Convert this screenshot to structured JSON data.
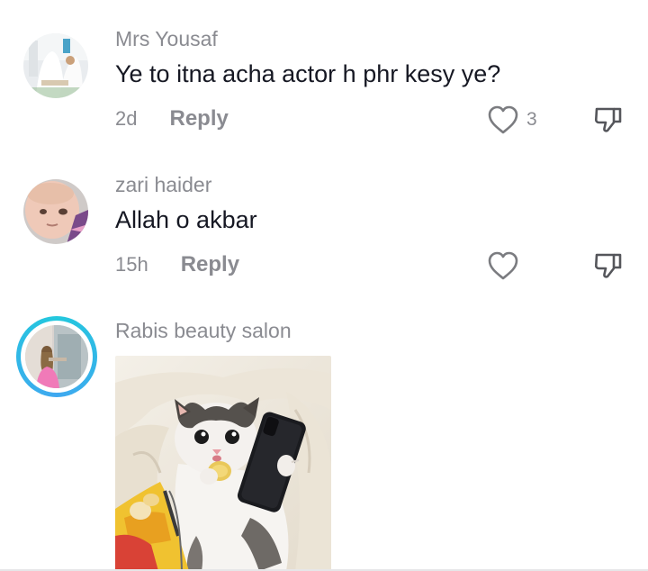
{
  "comments": [
    {
      "username": "Mrs Yousaf",
      "text": "Ye to itna acha actor h phr kesy ye?",
      "time": "2d",
      "reply_label": "Reply",
      "like_count": "3"
    },
    {
      "username": "zari haider",
      "text": "Allah o akbar",
      "time": "15h",
      "reply_label": "Reply",
      "like_count": ""
    },
    {
      "username": "Rabis beauty salon",
      "has_story_ring": true,
      "attachment": "kitten-with-phone-sticker"
    }
  ],
  "colors": {
    "text": "#161823",
    "muted": "#8a8b91",
    "story_ring": "#23c8dd"
  },
  "icons": [
    "heart-icon",
    "dislike-icon"
  ]
}
